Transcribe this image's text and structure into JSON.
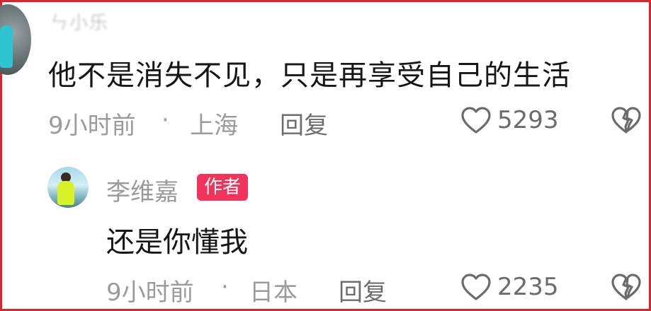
{
  "top_comment": {
    "username": "ㄣ小乐",
    "text": "他不是消失不见，只是再享受自己的生活",
    "time": "9小时前",
    "separator": "·",
    "location": "上海",
    "reply_label": "回复",
    "like_count": "5293"
  },
  "reply_comment": {
    "username": "李维嘉",
    "badge": "作者",
    "text": "还是你懂我",
    "time": "9小时前",
    "separator": "·",
    "location": "日本",
    "reply_label": "回复",
    "like_count": "2235"
  },
  "colors": {
    "frame": "#d9262c",
    "badge": "#f2335a",
    "meta_text": "#9b9b9b"
  },
  "icons": {
    "like": "heart-outline",
    "dislike": "broken-heart-outline"
  }
}
